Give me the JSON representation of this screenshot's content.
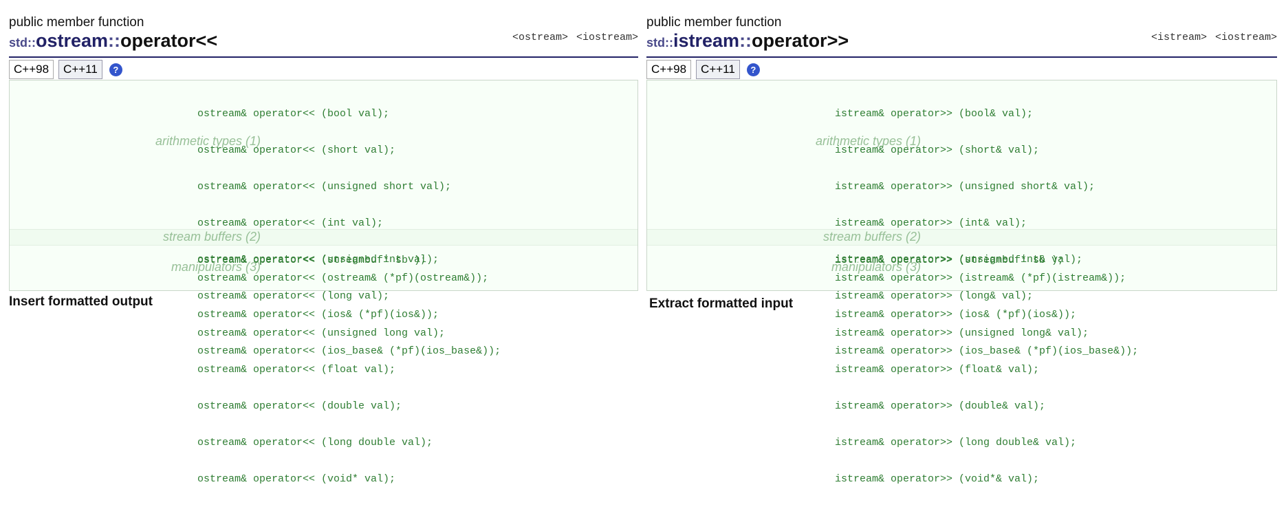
{
  "left": {
    "kind": "public member function",
    "title": {
      "ns": "std::",
      "cls": "ostream",
      "sep": "::",
      "fn": "operator<<"
    },
    "headers": [
      "<ostream>",
      "<iostream>"
    ],
    "tabs": [
      "C++98",
      "C++11"
    ],
    "help_icon": "?",
    "groups": [
      {
        "label": "arithmetic types (1)",
        "lines": [
          "ostream& operator<< (bool val);",
          "ostream& operator<< (short val);",
          "ostream& operator<< (unsigned short val);",
          "ostream& operator<< (int val);",
          "ostream& operator<< (unsigned int val);",
          "ostream& operator<< (long val);",
          "ostream& operator<< (unsigned long val);",
          "ostream& operator<< (float val);",
          "ostream& operator<< (double val);",
          "ostream& operator<< (long double val);",
          "ostream& operator<< (void* val);"
        ]
      },
      {
        "label": "stream buffers (2)",
        "lines": [
          "ostream& operator<< (streambuf* sb );"
        ]
      },
      {
        "label": "manipulators (3)",
        "lines": [
          "ostream& operator<< (ostream& (*pf)(ostream&));",
          "ostream& operator<< (ios& (*pf)(ios&));",
          "ostream& operator<< (ios_base& (*pf)(ios_base&));"
        ]
      }
    ],
    "caption": "Insert formatted output"
  },
  "right": {
    "kind": "public member function",
    "title": {
      "ns": "std::",
      "cls": "istream",
      "sep": "::",
      "fn": "operator>>"
    },
    "headers": [
      "<istream>",
      "<iostream>"
    ],
    "tabs": [
      "C++98",
      "C++11"
    ],
    "help_icon": "?",
    "groups": [
      {
        "label": "arithmetic types (1)",
        "lines": [
          "istream& operator>> (bool& val);",
          "istream& operator>> (short& val);",
          "istream& operator>> (unsigned short& val);",
          "istream& operator>> (int& val);",
          "istream& operator>> (unsigned int& val);",
          "istream& operator>> (long& val);",
          "istream& operator>> (unsigned long& val);",
          "istream& operator>> (float& val);",
          "istream& operator>> (double& val);",
          "istream& operator>> (long double& val);",
          "istream& operator>> (void*& val);"
        ]
      },
      {
        "label": "stream buffers (2)",
        "lines": [
          "istream& operator>> (streambuf* sb );"
        ]
      },
      {
        "label": "manipulators (3)",
        "lines": [
          "istream& operator>> (istream& (*pf)(istream&));",
          "istream& operator>> (ios& (*pf)(ios&));",
          "istream& operator>> (ios_base& (*pf)(ios_base&));"
        ]
      }
    ],
    "caption": "Extract formatted input"
  }
}
